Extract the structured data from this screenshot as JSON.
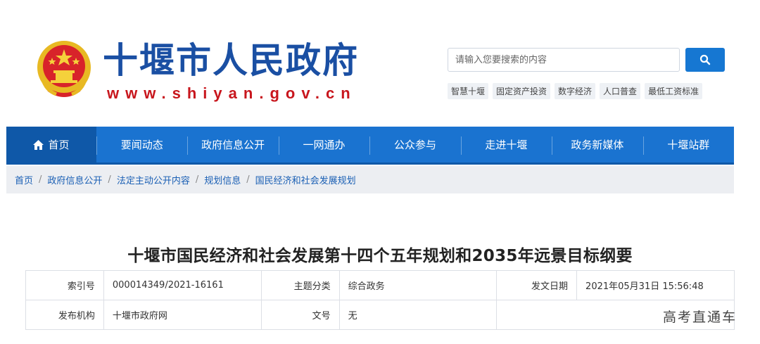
{
  "header": {
    "site_title": "十堰市人民政府",
    "site_url": "www.shiyan.gov.cn",
    "emblem_icon": "national-emblem-icon",
    "search": {
      "placeholder": "请输入您要搜索的内容",
      "button_icon": "search-icon"
    },
    "hot_links": [
      "智慧十堰",
      "固定资产投资",
      "数字经济",
      "人口普查",
      "最低工资标准"
    ]
  },
  "nav": {
    "home_label": "首页",
    "home_icon": "home-icon",
    "items": [
      "要闻动态",
      "政府信息公开",
      "一网通办",
      "公众参与",
      "走进十堰",
      "政务新媒体",
      "十堰站群"
    ]
  },
  "breadcrumb": [
    "首页",
    "政府信息公开",
    "法定主动公开内容",
    "规划信息",
    "国民经济和社会发展规划"
  ],
  "page_title": "十堰市国民经济和社会发展第十四个五年规划和2035年远景目标纲要",
  "info": {
    "index_label": "索引号",
    "index_value": "000014349/2021-16161",
    "topic_label": "主题分类",
    "topic_value": "综合政务",
    "date_label": "发文日期",
    "date_value": "2021年05月31日 15:56:48",
    "org_label": "发布机构",
    "org_value": "十堰市政府网",
    "docno_label": "文号",
    "docno_value": "无"
  },
  "watermark": "高考直通车",
  "colors": {
    "brand_blue": "#1a73d0",
    "nav_dark": "#0f58a8",
    "url_red": "#c8161d",
    "title_blue": "#1a4fa3"
  }
}
